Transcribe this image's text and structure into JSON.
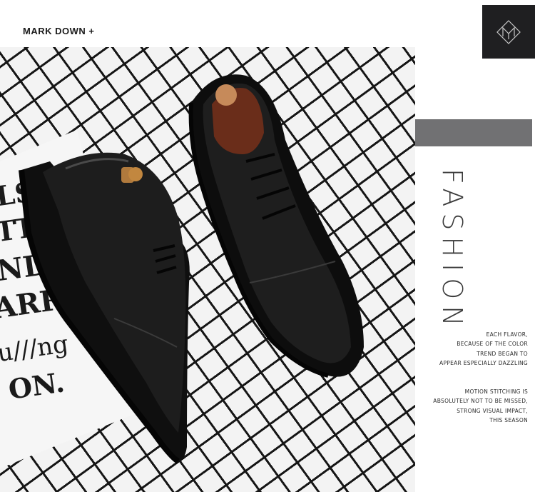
{
  "header": {
    "title": "MARK DOWN +"
  },
  "logo": {
    "icon": "monogram-logo-icon",
    "background": "#1f1f21",
    "stroke": "#c8c8c8"
  },
  "photo": {
    "magazine_lines": [
      "LSI",
      "TTL",
      "ND",
      "ARRA",
      "u///ng",
      "ON."
    ]
  },
  "side": {
    "bar_color": "#717173",
    "vertical_title": "FASHION",
    "paragraph1": [
      "EACH FLAVOR,",
      "BECAUSE OF THE COLOR",
      "TREND BEGAN TO",
      "APPEAR ESPECIALLY DAZZLING"
    ],
    "paragraph2": [
      "MOTION STITCHING IS",
      "ABSOLUTELY NOT TO BE MISSED,",
      "STRONG VISUAL IMPACT,",
      "THIS SEASON"
    ]
  }
}
